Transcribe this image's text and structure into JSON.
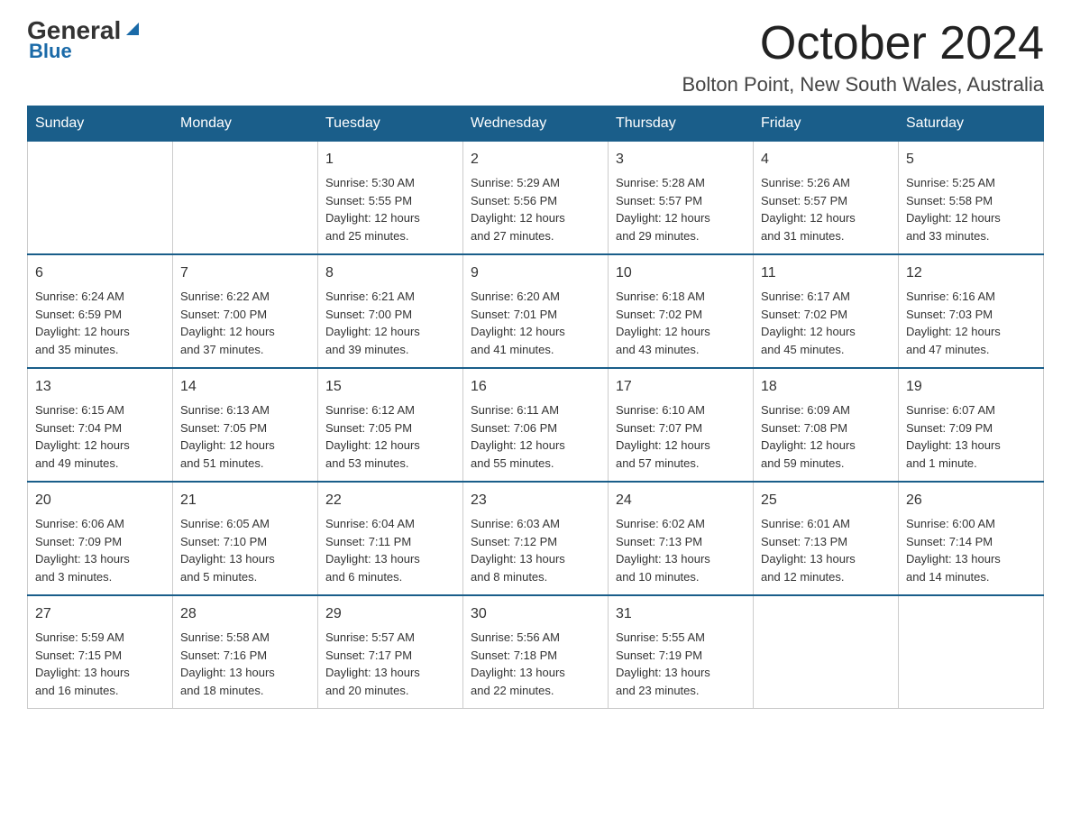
{
  "logo": {
    "general": "General",
    "blue": "Blue"
  },
  "title": "October 2024",
  "location": "Bolton Point, New South Wales, Australia",
  "days_of_week": [
    "Sunday",
    "Monday",
    "Tuesday",
    "Wednesday",
    "Thursday",
    "Friday",
    "Saturday"
  ],
  "weeks": [
    [
      {
        "day": "",
        "content": ""
      },
      {
        "day": "",
        "content": ""
      },
      {
        "day": "1",
        "content": "Sunrise: 5:30 AM\nSunset: 5:55 PM\nDaylight: 12 hours\nand 25 minutes."
      },
      {
        "day": "2",
        "content": "Sunrise: 5:29 AM\nSunset: 5:56 PM\nDaylight: 12 hours\nand 27 minutes."
      },
      {
        "day": "3",
        "content": "Sunrise: 5:28 AM\nSunset: 5:57 PM\nDaylight: 12 hours\nand 29 minutes."
      },
      {
        "day": "4",
        "content": "Sunrise: 5:26 AM\nSunset: 5:57 PM\nDaylight: 12 hours\nand 31 minutes."
      },
      {
        "day": "5",
        "content": "Sunrise: 5:25 AM\nSunset: 5:58 PM\nDaylight: 12 hours\nand 33 minutes."
      }
    ],
    [
      {
        "day": "6",
        "content": "Sunrise: 6:24 AM\nSunset: 6:59 PM\nDaylight: 12 hours\nand 35 minutes."
      },
      {
        "day": "7",
        "content": "Sunrise: 6:22 AM\nSunset: 7:00 PM\nDaylight: 12 hours\nand 37 minutes."
      },
      {
        "day": "8",
        "content": "Sunrise: 6:21 AM\nSunset: 7:00 PM\nDaylight: 12 hours\nand 39 minutes."
      },
      {
        "day": "9",
        "content": "Sunrise: 6:20 AM\nSunset: 7:01 PM\nDaylight: 12 hours\nand 41 minutes."
      },
      {
        "day": "10",
        "content": "Sunrise: 6:18 AM\nSunset: 7:02 PM\nDaylight: 12 hours\nand 43 minutes."
      },
      {
        "day": "11",
        "content": "Sunrise: 6:17 AM\nSunset: 7:02 PM\nDaylight: 12 hours\nand 45 minutes."
      },
      {
        "day": "12",
        "content": "Sunrise: 6:16 AM\nSunset: 7:03 PM\nDaylight: 12 hours\nand 47 minutes."
      }
    ],
    [
      {
        "day": "13",
        "content": "Sunrise: 6:15 AM\nSunset: 7:04 PM\nDaylight: 12 hours\nand 49 minutes."
      },
      {
        "day": "14",
        "content": "Sunrise: 6:13 AM\nSunset: 7:05 PM\nDaylight: 12 hours\nand 51 minutes."
      },
      {
        "day": "15",
        "content": "Sunrise: 6:12 AM\nSunset: 7:05 PM\nDaylight: 12 hours\nand 53 minutes."
      },
      {
        "day": "16",
        "content": "Sunrise: 6:11 AM\nSunset: 7:06 PM\nDaylight: 12 hours\nand 55 minutes."
      },
      {
        "day": "17",
        "content": "Sunrise: 6:10 AM\nSunset: 7:07 PM\nDaylight: 12 hours\nand 57 minutes."
      },
      {
        "day": "18",
        "content": "Sunrise: 6:09 AM\nSunset: 7:08 PM\nDaylight: 12 hours\nand 59 minutes."
      },
      {
        "day": "19",
        "content": "Sunrise: 6:07 AM\nSunset: 7:09 PM\nDaylight: 13 hours\nand 1 minute."
      }
    ],
    [
      {
        "day": "20",
        "content": "Sunrise: 6:06 AM\nSunset: 7:09 PM\nDaylight: 13 hours\nand 3 minutes."
      },
      {
        "day": "21",
        "content": "Sunrise: 6:05 AM\nSunset: 7:10 PM\nDaylight: 13 hours\nand 5 minutes."
      },
      {
        "day": "22",
        "content": "Sunrise: 6:04 AM\nSunset: 7:11 PM\nDaylight: 13 hours\nand 6 minutes."
      },
      {
        "day": "23",
        "content": "Sunrise: 6:03 AM\nSunset: 7:12 PM\nDaylight: 13 hours\nand 8 minutes."
      },
      {
        "day": "24",
        "content": "Sunrise: 6:02 AM\nSunset: 7:13 PM\nDaylight: 13 hours\nand 10 minutes."
      },
      {
        "day": "25",
        "content": "Sunrise: 6:01 AM\nSunset: 7:13 PM\nDaylight: 13 hours\nand 12 minutes."
      },
      {
        "day": "26",
        "content": "Sunrise: 6:00 AM\nSunset: 7:14 PM\nDaylight: 13 hours\nand 14 minutes."
      }
    ],
    [
      {
        "day": "27",
        "content": "Sunrise: 5:59 AM\nSunset: 7:15 PM\nDaylight: 13 hours\nand 16 minutes."
      },
      {
        "day": "28",
        "content": "Sunrise: 5:58 AM\nSunset: 7:16 PM\nDaylight: 13 hours\nand 18 minutes."
      },
      {
        "day": "29",
        "content": "Sunrise: 5:57 AM\nSunset: 7:17 PM\nDaylight: 13 hours\nand 20 minutes."
      },
      {
        "day": "30",
        "content": "Sunrise: 5:56 AM\nSunset: 7:18 PM\nDaylight: 13 hours\nand 22 minutes."
      },
      {
        "day": "31",
        "content": "Sunrise: 5:55 AM\nSunset: 7:19 PM\nDaylight: 13 hours\nand 23 minutes."
      },
      {
        "day": "",
        "content": ""
      },
      {
        "day": "",
        "content": ""
      }
    ]
  ]
}
